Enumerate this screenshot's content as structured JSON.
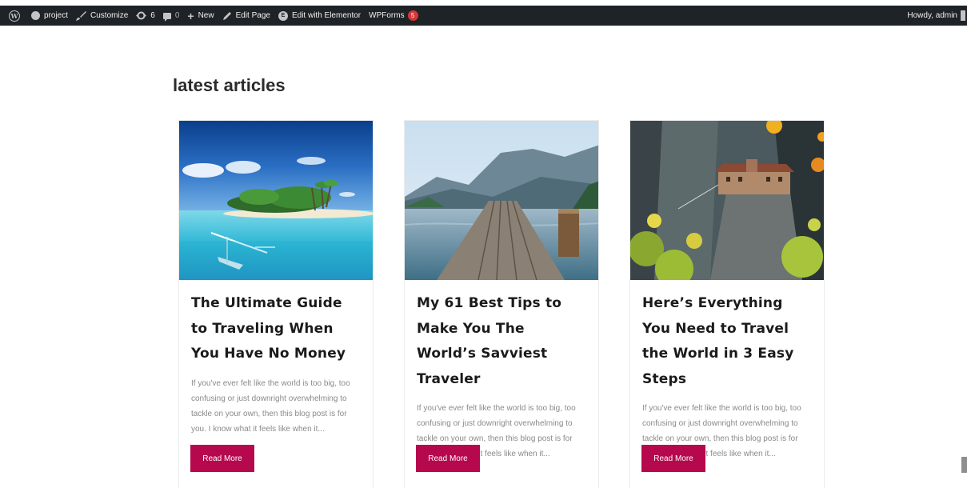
{
  "admin_bar": {
    "site_name": "project",
    "customize": "Customize",
    "updates_count": "6",
    "comments_count": "0",
    "new": "New",
    "edit_page": "Edit Page",
    "edit_elementor": "Edit with Elementor",
    "wpforms": "WPForms",
    "wpforms_badge": "5",
    "howdy": "Howdy, admin",
    "icons": [
      "wordpress-logo-icon",
      "dashboard-icon",
      "brush-icon",
      "refresh-icon",
      "comment-icon",
      "plus-icon",
      "pencil-icon",
      "elementor-icon"
    ]
  },
  "section": {
    "title": "latest articles"
  },
  "articles": [
    {
      "image": "tropical-island-with-outrigger-boat",
      "title": "The Ultimate Guide to Traveling When You Have No Money",
      "excerpt": "If you've ever felt like the world is too big, too confusing or just downright overwhelming to tackle on your own, then this blog post is for you. I know what it feels like when it...",
      "button": "Read More"
    },
    {
      "image": "wooden-pier-over-mountain-lake",
      "title": "My 61 Best Tips to Make You The World’s Savviest Traveler",
      "excerpt": "If you've ever felt like the world is too big, too confusing or just downright overwhelming to tackle on your own, then this blog post is for you. I know what it feels like when it...",
      "button": "Read More"
    },
    {
      "image": "cliff-monastery-with-flowers",
      "title": "Here’s Everything You Need to Travel the World in 3 Easy Steps",
      "excerpt": "If you've ever felt like the world is too big, too confusing or just downright overwhelming to tackle on your own, then this blog post is for you. I know what it feels like when it...",
      "button": "Read More"
    }
  ],
  "colors": {
    "admin_bar_bg": "#1d2327",
    "button_bg": "#b5084d",
    "badge_bg": "#d63638",
    "title_text": "#1a1a1a",
    "excerpt_text": "#8a8a8a"
  }
}
